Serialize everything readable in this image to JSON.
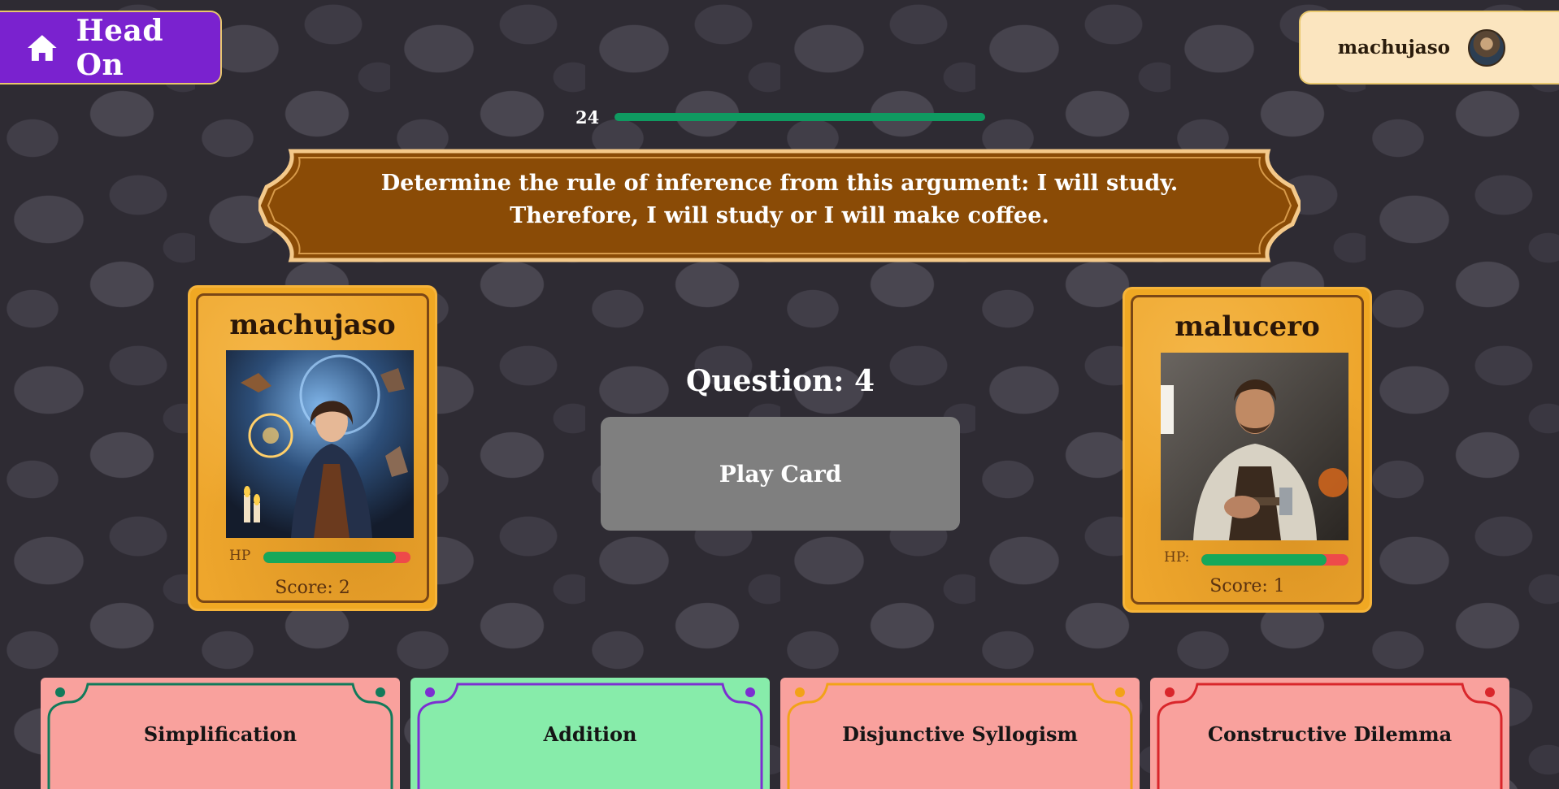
{
  "header": {
    "app_title": "Head On",
    "home_icon": "house-icon",
    "username": "machujaso"
  },
  "timer": {
    "seconds_left": "24",
    "progress_fraction": 1.0,
    "color": "#0f9a61"
  },
  "question": {
    "text": "Determine the rule of inference from this argument: I will study. Therefore, I will study or I will make coffee.",
    "number_label": "Question:",
    "number": "4"
  },
  "play_button": {
    "label": "Play Card",
    "color": "#7f7f7f"
  },
  "players": [
    {
      "name": "machujaso",
      "hp_label": "HP",
      "hp_fraction": 0.9,
      "score_label": "Score:",
      "score": "2",
      "portrait": "sorceress-portrait"
    },
    {
      "name": "malucero",
      "hp_label": "HP:",
      "hp_fraction": 0.85,
      "score_label": "Score:",
      "score": "1",
      "portrait": "blacksmith-portrait"
    }
  ],
  "answers": [
    {
      "label": "Simplification",
      "bg": "#f9a19d",
      "accent": "#127a5a"
    },
    {
      "label": "Addition",
      "bg": "#87ecaa",
      "accent": "#7c2fd1"
    },
    {
      "label": "Disjunctive Syllogism",
      "bg": "#f9a19d",
      "accent": "#f2a218"
    },
    {
      "label": "Constructive Dilemma",
      "bg": "#f9a19d",
      "accent": "#d9262b"
    }
  ],
  "colors": {
    "brand_purple": "#7a22cf",
    "banner_brown": "#8a4b06",
    "card_gold": "#f0a823",
    "hp_green": "#16a85a",
    "hp_red": "#ee4a4a"
  }
}
